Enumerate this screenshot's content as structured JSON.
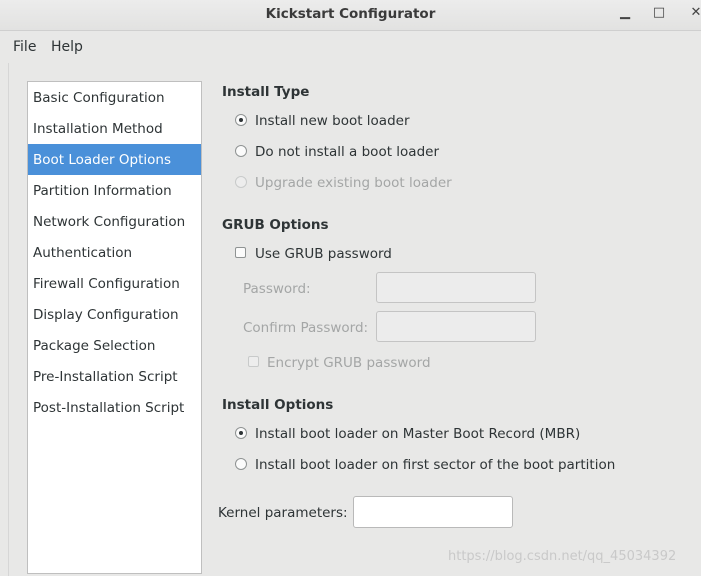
{
  "window": {
    "title": "Kickstart Configurator",
    "minimize_glyph": "▁",
    "maximize_glyph": "□",
    "close_glyph": "✕"
  },
  "menubar": {
    "file": "File",
    "help": "Help"
  },
  "sidebar": {
    "items": [
      {
        "label": "Basic Configuration"
      },
      {
        "label": "Installation Method"
      },
      {
        "label": "Boot Loader Options",
        "active": true
      },
      {
        "label": "Partition Information"
      },
      {
        "label": "Network Configuration"
      },
      {
        "label": "Authentication"
      },
      {
        "label": "Firewall Configuration"
      },
      {
        "label": "Display Configuration"
      },
      {
        "label": "Package Selection"
      },
      {
        "label": "Pre-Installation Script"
      },
      {
        "label": "Post-Installation Script"
      }
    ]
  },
  "install_type": {
    "title": "Install Type",
    "options": [
      {
        "label": "Install new boot loader",
        "selected": true,
        "enabled": true
      },
      {
        "label": "Do not install a boot loader",
        "selected": false,
        "enabled": true
      },
      {
        "label": "Upgrade existing boot loader",
        "selected": false,
        "enabled": false
      }
    ]
  },
  "grub_options": {
    "title": "GRUB Options",
    "use_password": {
      "label": "Use GRUB password",
      "checked": false
    },
    "password_label": "Password:",
    "password_value": "",
    "confirm_label": "Confirm Password:",
    "confirm_value": "",
    "encrypt": {
      "label": "Encrypt GRUB password",
      "checked": false,
      "enabled": false
    }
  },
  "install_options": {
    "title": "Install Options",
    "options": [
      {
        "label": "Install boot loader on Master Boot Record (MBR)",
        "selected": true
      },
      {
        "label": "Install boot loader on first sector of the boot partition",
        "selected": false
      }
    ]
  },
  "kernel": {
    "label": "Kernel parameters:",
    "value": ""
  },
  "watermark": "https://blog.csdn.net/qq_45034392",
  "colors": {
    "accent": "#4a90d9",
    "disabled_text": "#a4a6a6",
    "window_bg": "#e8e8e7"
  }
}
